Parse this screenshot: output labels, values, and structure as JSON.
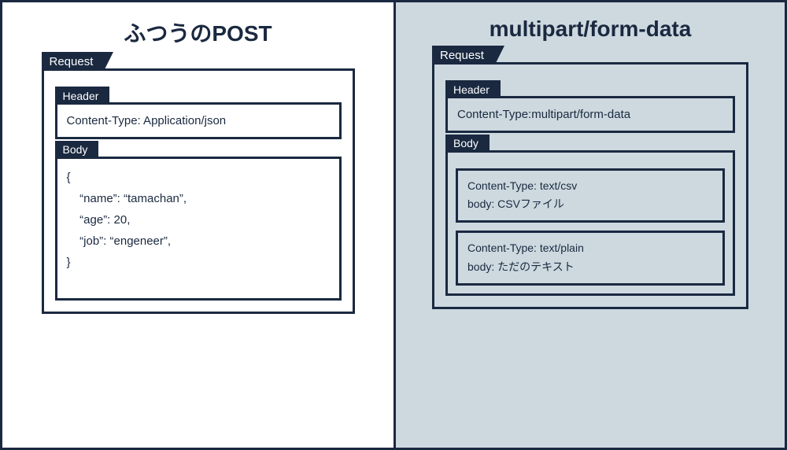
{
  "left": {
    "title": "ふつうのPOST",
    "request_tab": "Request",
    "header_tab": "Header",
    "header_content": "Content-Type: Application/json",
    "body_tab": "Body",
    "body_content": "{\n    “name”: “tamachan”,\n    “age”: 20,\n    “job”: “engeneer”,\n}"
  },
  "right": {
    "title": "multipart/form-data",
    "request_tab": "Request",
    "header_tab": "Header",
    "header_content": "Content-Type:multipart/form-data",
    "body_tab": "Body",
    "parts": [
      {
        "content_type": "Content-Type: text/csv",
        "body": "body: CSVファイル"
      },
      {
        "content_type": "Content-Type: text/plain",
        "body": "body: ただのテキスト"
      }
    ]
  }
}
